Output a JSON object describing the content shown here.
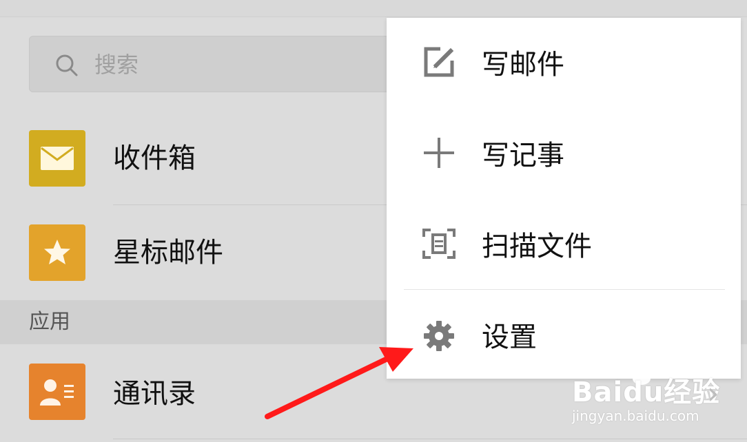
{
  "search": {
    "placeholder": "搜索",
    "icon": "search-icon"
  },
  "folders": [
    {
      "label": "收件箱",
      "icon": "envelope-icon",
      "color": "#d2ac20"
    },
    {
      "label": "星标邮件",
      "icon": "star-icon",
      "color": "#e3a32b"
    }
  ],
  "section": {
    "apps_title": "应用"
  },
  "apps": [
    {
      "label": "通讯录",
      "icon": "contact-card-icon",
      "color": "#e6832d"
    }
  ],
  "popup_menu": {
    "items": [
      {
        "label": "写邮件",
        "icon": "compose-icon"
      },
      {
        "label": "写记事",
        "icon": "plus-icon"
      },
      {
        "label": "扫描文件",
        "icon": "scan-icon"
      },
      {
        "label": "设置",
        "icon": "gear-icon"
      }
    ]
  },
  "annotation": {
    "arrow_color": "#ff1a1a"
  },
  "watermark": {
    "main": "Baidu经验",
    "sub": "jingyan.baidu.com"
  }
}
